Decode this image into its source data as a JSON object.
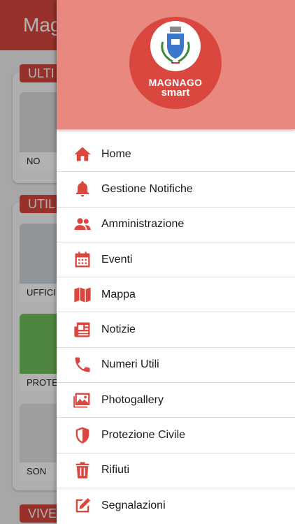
{
  "background": {
    "title": "Mag",
    "sections": [
      {
        "label": "ULTI"
      },
      {
        "label": "UTIL"
      },
      {
        "label": "VIVE"
      }
    ],
    "cards": [
      {
        "caption": "NO"
      },
      {
        "caption": "UFFICI C"
      },
      {
        "caption": "PROTEZIO"
      },
      {
        "caption": "SON"
      }
    ]
  },
  "drawer": {
    "logo_line1": "MAGNAGO",
    "logo_line2": "smart",
    "menu": [
      {
        "label": "Home",
        "icon": "home-icon"
      },
      {
        "label": "Gestione Notifiche",
        "icon": "bell-icon"
      },
      {
        "label": "Amministrazione",
        "icon": "users-icon"
      },
      {
        "label": "Eventi",
        "icon": "calendar-icon"
      },
      {
        "label": "Mappa",
        "icon": "map-icon"
      },
      {
        "label": "Notizie",
        "icon": "newspaper-icon"
      },
      {
        "label": "Numeri Utili",
        "icon": "phone-icon"
      },
      {
        "label": "Photogallery",
        "icon": "images-icon"
      },
      {
        "label": "Protezione Civile",
        "icon": "shield-icon"
      },
      {
        "label": "Rifiuti",
        "icon": "trash-icon"
      },
      {
        "label": "Segnalazioni",
        "icon": "edit-icon"
      }
    ]
  },
  "colors": {
    "accent": "#d9473f",
    "drawer_header": "#e8887f"
  }
}
